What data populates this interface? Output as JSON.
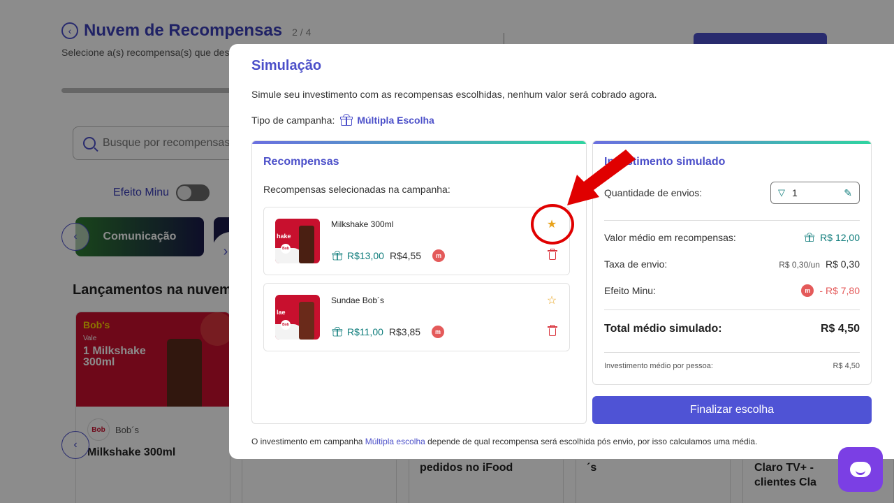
{
  "background": {
    "title": "Nuvem de Recompensas",
    "step": "2 / 4",
    "subtitle": "Selecione a(s) recompensa(s) que des",
    "search_placeholder": "Busque por recompensas",
    "efeito_label": "Efeito Minu",
    "category": "Comunicação",
    "section_title": "Lançamentos na nuvem",
    "card": {
      "logo": "Bob's",
      "vale": "Vale",
      "product": "1 Milkshake 300ml",
      "brand": "Bob´s",
      "name": "Milkshake 300ml"
    },
    "bottom_cards": [
      "pedidos no iFood",
      "´s",
      "Claro TV+ - clientes Cla"
    ]
  },
  "modal": {
    "title": "Simulação",
    "description": "Simule seu investimento com as recompensas escolhidas, nenhum valor será cobrado agora.",
    "campaign_type_label": "Tipo de campanha:",
    "campaign_type_value": "Múltipla Escolha",
    "rewards": {
      "title": "Recompensas",
      "subtitle": "Recompensas selecionadas na campanha:",
      "items": [
        {
          "name": "Milkshake 300ml",
          "gift_price": "R$13,00",
          "final_price": "R$4,55",
          "thumb_text": "hake",
          "favorite": true
        },
        {
          "name": "Sundae Bob´s",
          "gift_price": "R$11,00",
          "final_price": "R$3,85",
          "thumb_text": "lae",
          "favorite": false
        }
      ]
    },
    "investment": {
      "title": "Investimento simulado",
      "quantity_label": "Quantidade de envios:",
      "quantity_value": "1",
      "avg_reward_label": "Valor médio em recompensas:",
      "avg_reward_value": "R$ 12,00",
      "fee_label": "Taxa de envio:",
      "fee_unit": "R$ 0,30/un",
      "fee_value": "R$ 0,30",
      "minu_label": "Efeito Minu:",
      "minu_value": "- R$ 7,80",
      "total_label": "Total médio simulado:",
      "total_value": "R$ 4,50",
      "per_person_label": "Investimento médio por pessoa:",
      "per_person_value": "R$ 4,50"
    },
    "finalize_button": "Finalizar escolha",
    "footnote_prefix": "O investimento em campanha ",
    "footnote_highlight": "Múltipla escolha",
    "footnote_suffix": " depende de qual recompensa será escolhida pós envio, por isso calculamos uma média."
  },
  "colors": {
    "primary": "#4b4fc9",
    "teal": "#0e7c7b",
    "danger": "#e45a5a",
    "star": "#e8a21a",
    "annotation": "#e00000"
  }
}
